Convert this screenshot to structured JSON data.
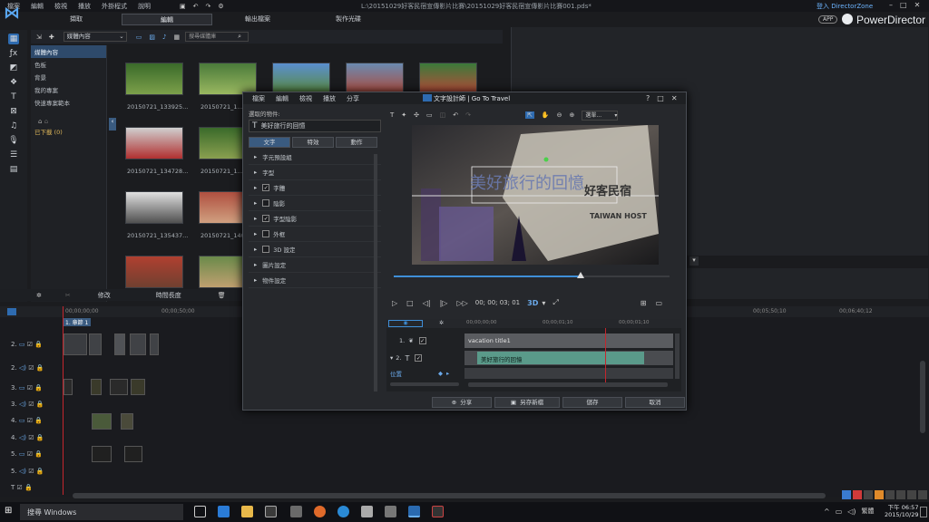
{
  "menu": [
    "檔案",
    "編輯",
    "檢視",
    "播放",
    "外掛程式",
    "說明"
  ],
  "title_path": "L:\\20151029好客民宿宣傳影片比賽\\20151029好客民宿宣傳影片比賽001.pds*",
  "login_link": "登入 DirectorZone",
  "app_badge": "APP",
  "app_name": "PowerDirector",
  "tabs": [
    "擷取",
    "編輯",
    "輸出檔案",
    "製作光碟"
  ],
  "library": {
    "dropdown": "媒體內容",
    "search_placeholder": "搜尋媒體庫",
    "side_items": [
      "媒體內容",
      "色板",
      "背景",
      "我的專案",
      "快速專案範本"
    ],
    "downloaded": "已下載 (0)",
    "thumbs": [
      "20150721_133925...",
      "20150721_1...",
      "20150721_134728...",
      "20150721_1...",
      "20150721_135437...",
      "20150721_140..."
    ]
  },
  "timeline": {
    "toolbar": [
      "修改",
      "時間長度"
    ],
    "chapter": "1. 章節 1",
    "time0": "00;00;00;00",
    "time1": "00;00;50;00",
    "time2": "00;05;50;10",
    "time3": "00;06;40;12",
    "tracks": [
      "2.",
      "2.",
      "3.",
      "3.",
      "4.",
      "4.",
      "5.",
      "5.",
      "T"
    ]
  },
  "dialog": {
    "menu": [
      "檔案",
      "編輯",
      "檢視",
      "播放",
      "分享"
    ],
    "title": "文字設計師  |  Go To Travel",
    "selected_label": "選取的物件:",
    "selected_value": "美好旅行的回憶",
    "tabs": [
      "文字",
      "特效",
      "動作"
    ],
    "props": [
      {
        "label": "字元預設組",
        "check": false,
        "has_box": false
      },
      {
        "label": "字型",
        "check": false,
        "has_box": false
      },
      {
        "label": "字體",
        "check": true,
        "has_box": true
      },
      {
        "label": "陰影",
        "check": false,
        "has_box": true
      },
      {
        "label": "字型陰影",
        "check": true,
        "has_box": true
      },
      {
        "label": "外框",
        "check": false,
        "has_box": true
      },
      {
        "label": "3D 設定",
        "check": false,
        "has_box": true
      },
      {
        "label": "圖片設定",
        "check": false,
        "has_box": false
      },
      {
        "label": "物件設定",
        "check": false,
        "has_box": false
      }
    ],
    "select_label": "選單...",
    "canvas_text": "美好旅行的回憶",
    "canvas_text2": "好客民宿",
    "canvas_host": "TAIWAN HOST",
    "timecode": "00; 00; 03; 01",
    "three_d": "3D",
    "tl_t1": "00;00;00;00",
    "tl_t2": "00;00;01;10",
    "tl_t3": "00;00;01;10",
    "track1_num": "1.",
    "track1_name": "vacation title1",
    "track2_num": "2.",
    "track2_name": "美好旅行的回憶",
    "position_label": "位置",
    "btn_share": "分享",
    "btn_saveas": "另存新檔",
    "btn_save": "儲存",
    "btn_cancel": "取消"
  },
  "taskbar": {
    "search": "搜尋 Windows",
    "lang": "繁體",
    "time": "下午 06:57",
    "date": "2015/10/29"
  }
}
